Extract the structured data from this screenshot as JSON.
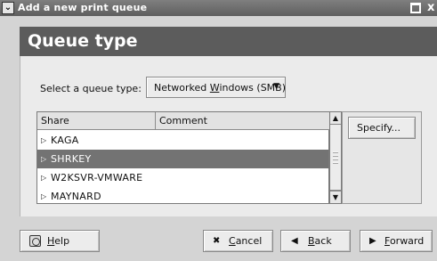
{
  "window": {
    "title": "Add a new print queue",
    "menu_glyph": "⌄",
    "close_glyph": "x"
  },
  "header": {
    "title": "Queue type"
  },
  "queue_type": {
    "label": "Select a queue type:",
    "value": "Networked Windows (SMB)"
  },
  "share_table": {
    "columns": [
      "Share",
      "Comment"
    ],
    "rows": [
      {
        "share": "KAGA",
        "comment": "",
        "selected": false
      },
      {
        "share": "SHRKEY",
        "comment": "",
        "selected": true
      },
      {
        "share": "W2KSVR-VMWARE",
        "comment": "",
        "selected": false
      },
      {
        "share": "MAYNARD",
        "comment": "",
        "selected": false
      }
    ]
  },
  "buttons": {
    "specify": "Specify...",
    "help": "Help",
    "cancel": "Cancel",
    "back": "Back",
    "forward": "Forward"
  },
  "icons": {
    "row_expander": "triangle-right-icon",
    "dropdown": "caret-down-icon",
    "cancel": "cancel-icon",
    "back": "arrow-left-icon",
    "forward": "arrow-right-icon",
    "help": "help-icon"
  },
  "colors": {
    "header_bg": "#5c5c5c",
    "selection_bg": "#737373",
    "titlebar_bg": "#6b6b6b"
  }
}
